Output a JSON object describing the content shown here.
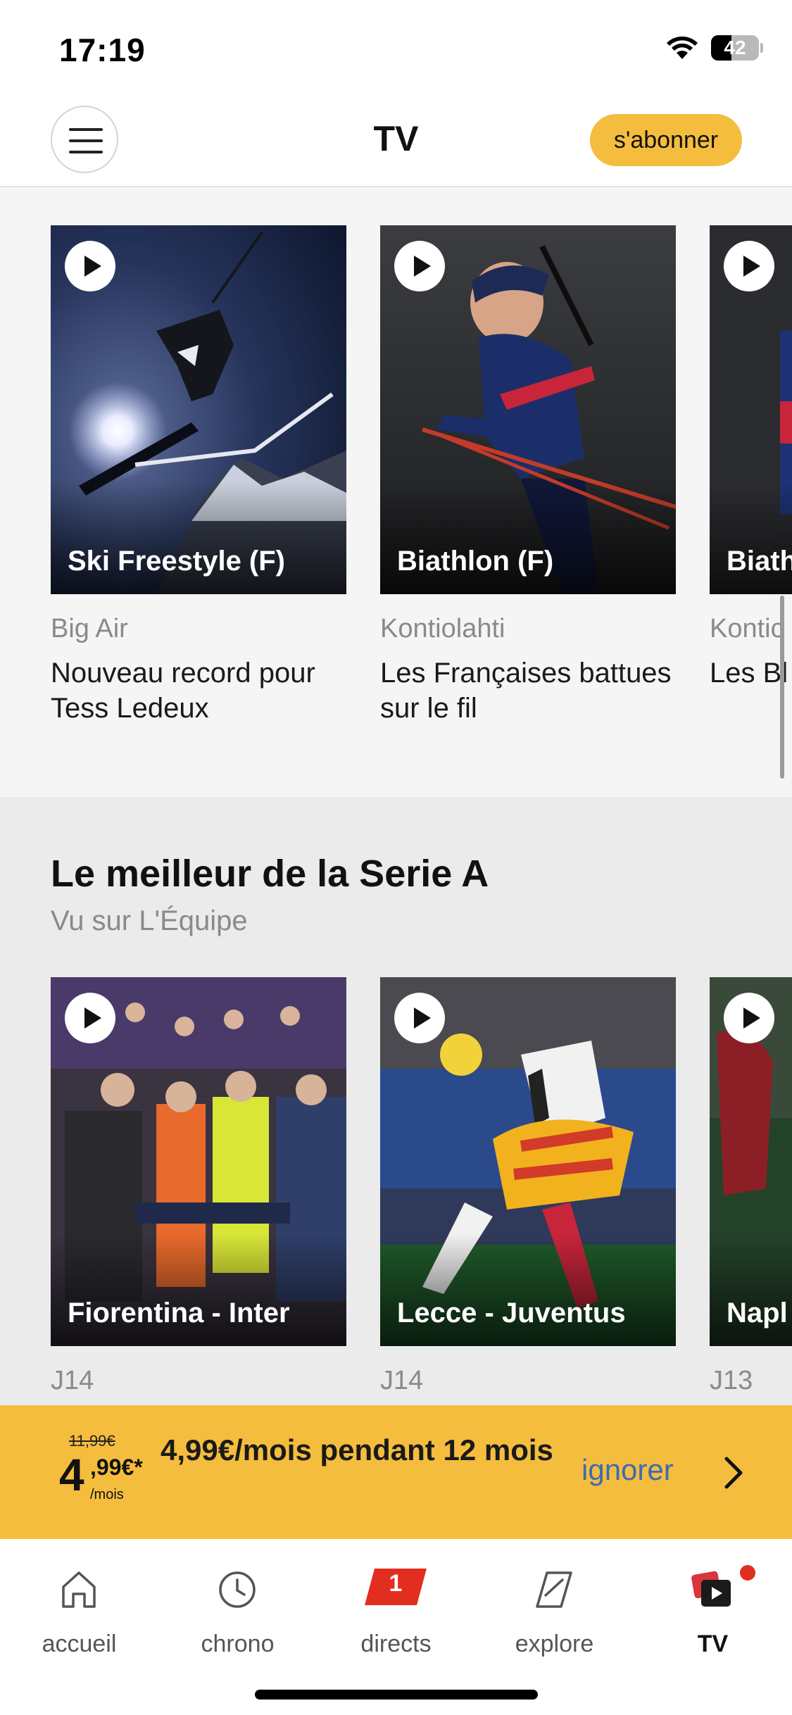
{
  "status_bar": {
    "time": "17:19",
    "battery": "42",
    "battery_level": 0.42
  },
  "header": {
    "title": "TV",
    "subscribe_label": "s'abonner"
  },
  "section_top": {
    "cards": [
      {
        "thumb_title": "Ski Freestyle (F)",
        "kicker": "Big Air",
        "headline": "Nouveau record pour Tess Ledeux"
      },
      {
        "thumb_title": "Biathlon (F)",
        "kicker": "Kontiolahti",
        "headline": "Les Françaises battues sur le fil"
      },
      {
        "thumb_title": "Biath",
        "kicker": "Kontic",
        "headline": "Les Bl le rela"
      }
    ]
  },
  "section_serie_a": {
    "title": "Le meilleur de la Serie A",
    "subtitle": "Vu sur L'Équipe",
    "cards": [
      {
        "thumb_title": "Fiorentina - Inter",
        "kicker": "J14"
      },
      {
        "thumb_title": "Lecce - Juventus",
        "kicker": "J14"
      },
      {
        "thumb_title": "Napl",
        "kicker": "J13"
      }
    ]
  },
  "promo": {
    "old_price": "11,99€",
    "new_price_whole": "4",
    "new_price_cents": ",99€*",
    "per_month": "/mois",
    "text": "4,99€/mois pendant 12 mois",
    "ignore_label": "ignorer"
  },
  "tab_bar": {
    "tabs": [
      {
        "label": "accueil",
        "icon": "home-icon"
      },
      {
        "label": "chrono",
        "icon": "clock-icon"
      },
      {
        "label": "directs",
        "icon": "live-badge-icon",
        "count": "1"
      },
      {
        "label": "explore",
        "icon": "explore-icon"
      },
      {
        "label": "TV",
        "icon": "tv-icon",
        "active": true
      }
    ]
  },
  "colors": {
    "accent": "#f5bd3d",
    "link": "#3b6bb5",
    "live_red": "#e12e1f"
  }
}
